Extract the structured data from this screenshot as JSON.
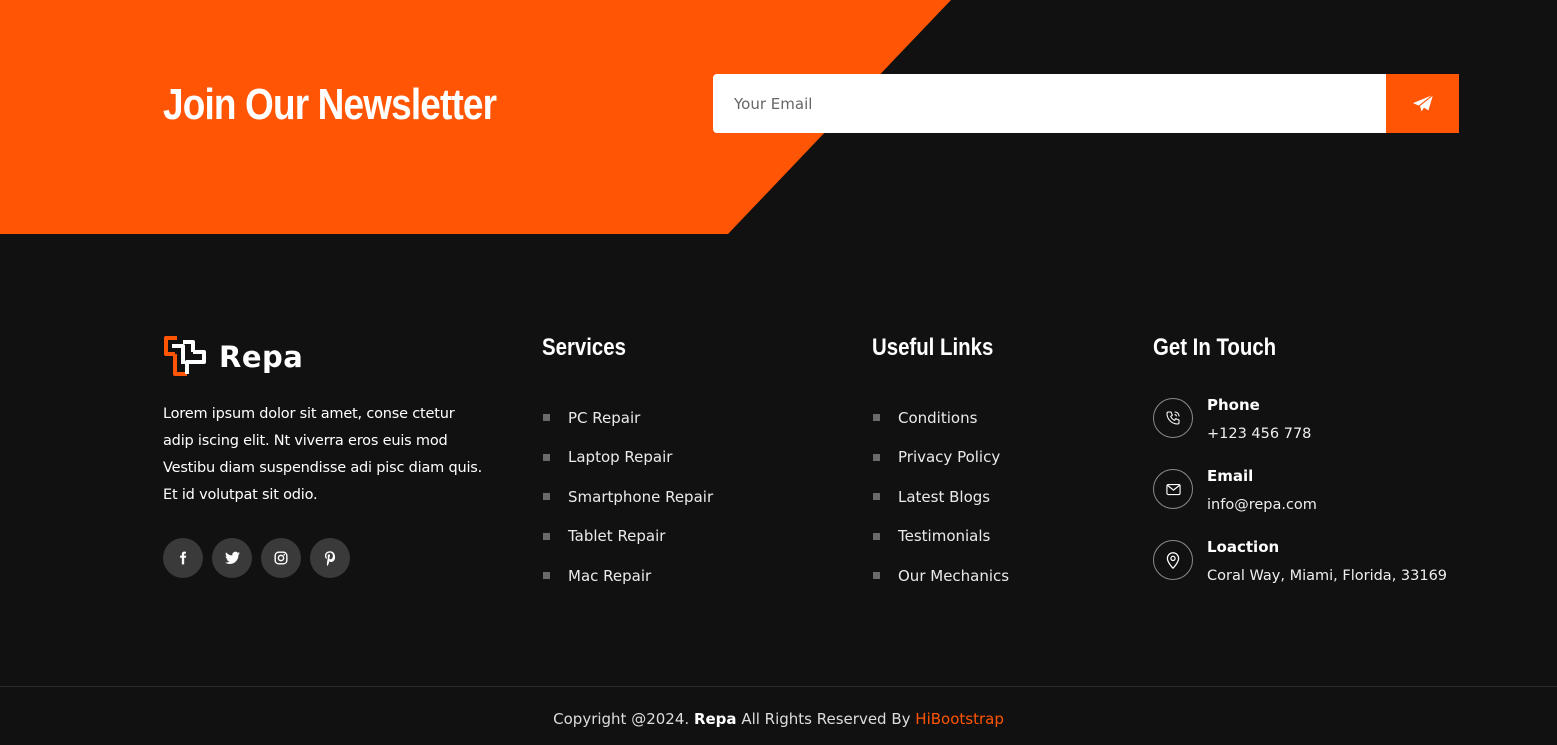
{
  "colors": {
    "accent": "#ff5505",
    "background": "#111111",
    "social_bg": "#3a3a3a"
  },
  "newsletter": {
    "title": "Join Our Newsletter",
    "email_placeholder": "Your Email",
    "submit_icon": "paper-plane-icon"
  },
  "brand": {
    "logo_icon": "repa-logo-icon",
    "name": "Repa"
  },
  "about": {
    "text": "Lorem ipsum dolor sit amet, conse ctetur adip iscing elit. Nt viverra eros euis mod Vestibu diam suspendisse adi pisc diam quis. Et id volutpat sit odio."
  },
  "socials": [
    {
      "icon": "facebook-icon"
    },
    {
      "icon": "twitter-icon"
    },
    {
      "icon": "instagram-icon"
    },
    {
      "icon": "pinterest-icon"
    }
  ],
  "services": {
    "title": "Services",
    "items": [
      "PC Repair",
      "Laptop Repair",
      "Smartphone Repair",
      "Tablet Repair",
      "Mac Repair"
    ]
  },
  "useful_links": {
    "title": "Useful Links",
    "items": [
      "Conditions",
      "Privacy Policy",
      "Latest Blogs",
      "Testimonials",
      "Our Mechanics"
    ]
  },
  "contact": {
    "title": "Get In Touch",
    "items": [
      {
        "icon": "phone-icon",
        "label": "Phone",
        "value": "+123 456 778"
      },
      {
        "icon": "mail-icon",
        "label": "Email",
        "value": "info@repa.com"
      },
      {
        "icon": "location-pin-icon",
        "label": "Loaction",
        "value": "Coral Way, Miami, Florida, 33169"
      }
    ]
  },
  "footer": {
    "copyright_prefix": "Copyright @2024.",
    "brand": "Repa",
    "rights": "All Rights Reserved By",
    "credit": "HiBootstrap"
  }
}
